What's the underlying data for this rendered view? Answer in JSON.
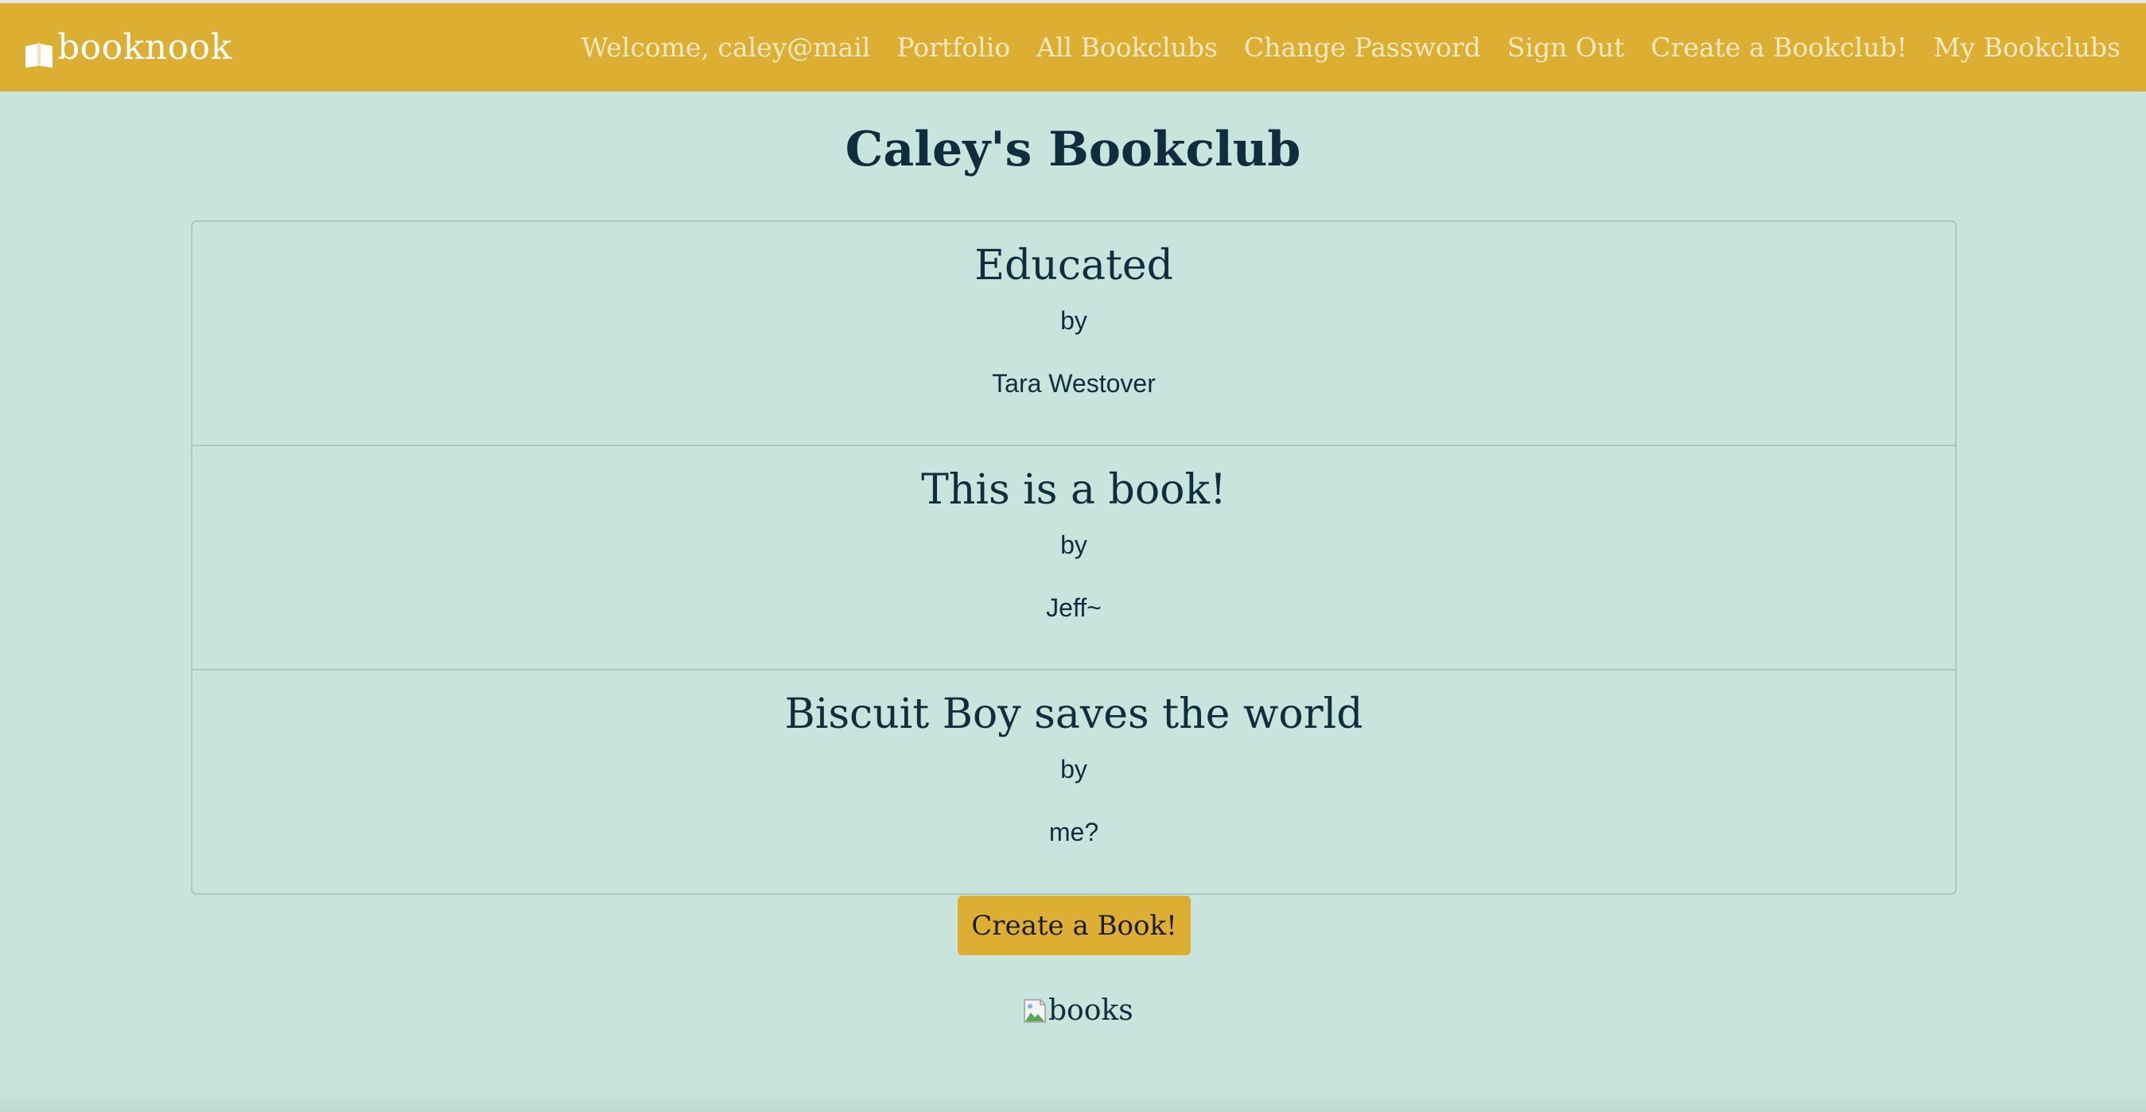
{
  "navbar": {
    "brand": "booknook",
    "links": [
      "Welcome, caley@mail",
      "Portfolio",
      "All Bookclubs",
      "Change Password",
      "Sign Out",
      "Create a Bookclub!",
      "My Bookclubs"
    ]
  },
  "page": {
    "title": "Caley's Bookclub"
  },
  "books": [
    {
      "title": "Educated",
      "by": "by",
      "author": "Tara Westover"
    },
    {
      "title": "This is a book!",
      "by": "by",
      "author": "Jeff~"
    },
    {
      "title": "Biscuit Boy saves the world",
      "by": "by",
      "author": "me?"
    }
  ],
  "create_button": "Create a Book!",
  "image": {
    "alt": "books"
  },
  "colors": {
    "navbar": "#dcae31",
    "background": "#c9e4dc",
    "text": "#0f2d3c"
  },
  "icons": {
    "brand": "open-book-icon",
    "image": "broken-image-icon"
  }
}
